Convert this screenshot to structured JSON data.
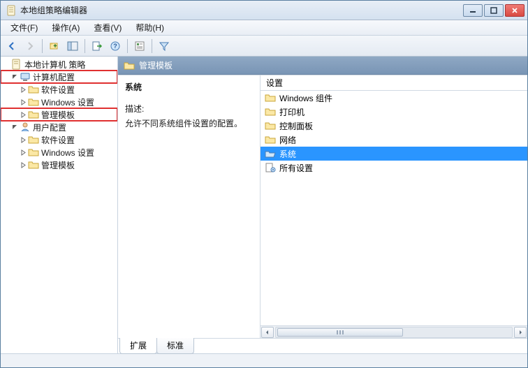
{
  "window": {
    "title": "本地组策略编辑器"
  },
  "menu": {
    "file": "文件(F)",
    "action": "操作(A)",
    "view": "查看(V)",
    "help": "帮助(H)"
  },
  "tree": {
    "root": "本地计算机 策略",
    "comp": "计算机配置",
    "comp_soft": "软件设置",
    "comp_win": "Windows 设置",
    "comp_tmpl": "管理模板",
    "user": "用户配置",
    "user_soft": "软件设置",
    "user_win": "Windows 设置",
    "user_tmpl": "管理模板"
  },
  "header": {
    "title": "管理模板"
  },
  "detail": {
    "selected": "系统",
    "desc_label": "描述:",
    "desc_text": "允许不同系统组件设置的配置。",
    "col_header": "设置",
    "items": {
      "0": "Windows 组件",
      "1": "打印机",
      "2": "控制面板",
      "3": "网络",
      "4": "系统",
      "5": "所有设置"
    }
  },
  "tabs": {
    "extended": "扩展",
    "standard": "标准"
  }
}
